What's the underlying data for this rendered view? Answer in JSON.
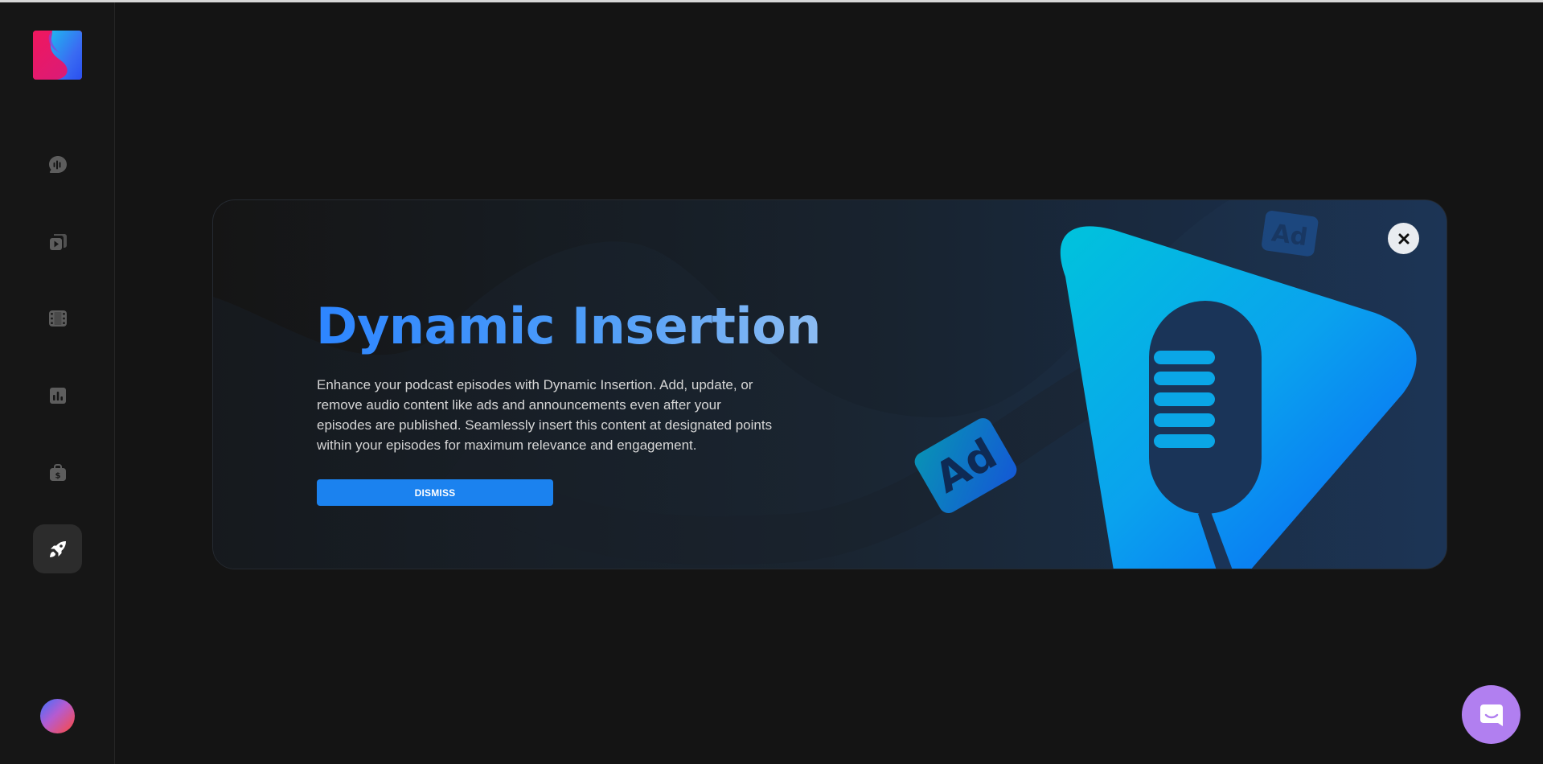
{
  "app": {
    "logo": "brand-logo",
    "colors": {
      "background": "#141414",
      "sidebar": "#161616",
      "accent": "#1b82ef",
      "chat_launcher": "#b17ff0"
    }
  },
  "sidebar": {
    "items": [
      {
        "icon": "podcast-mic-icon",
        "active": false
      },
      {
        "icon": "episodes-icon",
        "active": false
      },
      {
        "icon": "film-icon",
        "active": false
      },
      {
        "icon": "analytics-icon",
        "active": false
      },
      {
        "icon": "monetization-icon",
        "active": false
      },
      {
        "icon": "rocket-icon",
        "active": true
      }
    ],
    "avatar": "user-avatar"
  },
  "banner": {
    "title": "Dynamic Insertion",
    "description": "Enhance your podcast episodes with Dynamic Insertion. Add, update, or remove audio content like ads and announcements even after your episodes are published. Seamlessly insert this content at designated points within your episodes for maximum relevance and engagement.",
    "dismiss_label": "DISMISS",
    "close_icon": "close-icon",
    "illustration": {
      "icon": "microphone-illustration",
      "badge_text": "Ad"
    }
  },
  "chat": {
    "icon": "chat-icon"
  }
}
